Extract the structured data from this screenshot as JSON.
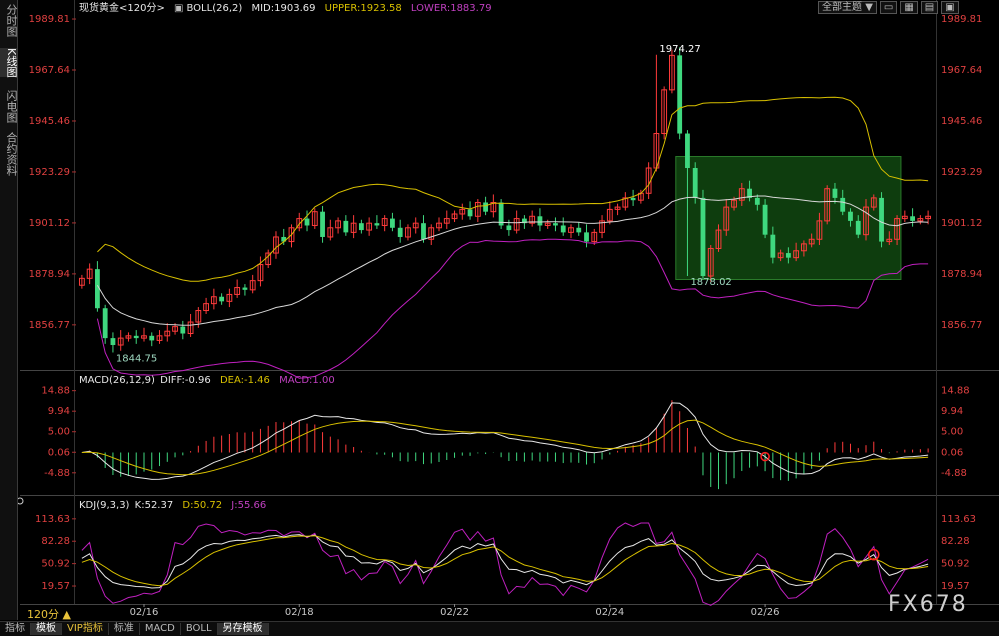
{
  "sidebar": {
    "tabs": [
      {
        "label": "分时图",
        "active": false
      },
      {
        "label": "K线图",
        "active": true
      },
      {
        "label": "闪电图",
        "active": false
      },
      {
        "label": "合约资料",
        "active": false
      }
    ]
  },
  "toolbar": {
    "theme_button": "全部主题",
    "dropdown_icon": "▼"
  },
  "period": "120分 ▲",
  "bottom_tabs": [
    {
      "label": "指标",
      "active": false,
      "vip": false
    },
    {
      "label": "模板",
      "active": true,
      "vip": false
    },
    {
      "label": "VIP指标",
      "active": false,
      "vip": true
    },
    {
      "label": "标准",
      "active": false,
      "vip": false
    },
    {
      "label": "MACD",
      "active": false,
      "vip": false
    },
    {
      "label": "BOLL",
      "active": false,
      "vip": false
    },
    {
      "label": "另存模板",
      "active": false,
      "vip": false
    }
  ],
  "watermark": "FX678",
  "colors": {
    "up": "#ff3b3b",
    "down": "#3fd87f",
    "mid": "#d8d8d8",
    "upper": "#d8c000",
    "lower": "#c020c0",
    "k": "#e8e8e8",
    "d": "#d8c000",
    "j": "#c020c0",
    "highlight": "#0e3d0e"
  },
  "chart_data": [
    {
      "type": "candlestick",
      "name_label": "现货黄金<120分>",
      "legend": {
        "indicator": "BOLL(26,2)",
        "mid": "MID:1903.69",
        "upper": "UPPER:1923.58",
        "lower": "LOWER:1883.79"
      },
      "ylim": [
        1838,
        1992
      ],
      "yticks": [
        1989.81,
        1967.64,
        1945.46,
        1923.29,
        1901.12,
        1878.94,
        1856.77
      ],
      "ytick_labels": [
        "1989.81",
        "1967.64",
        "1945.46",
        "1923.29",
        "1901.12",
        "1878.94",
        "1856.77"
      ],
      "xtick_labels": [
        "02/16",
        "02/18",
        "02/22",
        "02/24",
        "02/26"
      ],
      "xtick_index": [
        8,
        28,
        48,
        68,
        88
      ],
      "annotations": [
        {
          "label": "1974.27",
          "index": 74,
          "value": 1974.27
        },
        {
          "label": "1844.75",
          "index": 4,
          "value": 1844.75
        },
        {
          "label": "1878.02",
          "index": 78,
          "value": 1878.02
        }
      ],
      "highlight_region": {
        "from_index": 77,
        "to_index": 105,
        "y_from": 1876.5,
        "y_to": 1930
      },
      "close": [
        1877,
        1881,
        1864,
        1851,
        1848,
        1851,
        1852,
        1851,
        1852,
        1850,
        1852,
        1854,
        1856,
        1853,
        1858,
        1863,
        1866,
        1869,
        1867,
        1870,
        1873,
        1872,
        1876,
        1883,
        1888,
        1895,
        1893,
        1899,
        1903,
        1900,
        1906,
        1895,
        1899,
        1902,
        1897,
        1901,
        1898,
        1901,
        1900,
        1903,
        1899,
        1895,
        1899,
        1901,
        1894,
        1899,
        1901,
        1903,
        1905,
        1907,
        1904,
        1910,
        1906,
        1910,
        1900,
        1898,
        1903,
        1901,
        1904,
        1900,
        1901,
        1900,
        1897,
        1899,
        1897,
        1893,
        1897,
        1902,
        1907,
        1908,
        1912,
        1911,
        1914,
        1925,
        1940,
        1959,
        1974,
        1940,
        1925,
        1912,
        1878,
        1890,
        1898,
        1908,
        1911,
        1916,
        1912,
        1909,
        1896,
        1886,
        1888,
        1886,
        1889,
        1892,
        1894,
        1902,
        1916,
        1912,
        1906,
        1902,
        1896,
        1908,
        1912,
        1893,
        1894,
        1903,
        1904,
        1902,
        1903,
        1904
      ],
      "macd": {
        "legend": {
          "indicator": "MACD(26,12,9)",
          "diff": "DIFF:-0.96",
          "dea": "DEA:-1.46",
          "macd": "MACD:1.00"
        },
        "ylim": [
          -9.5,
          16
        ],
        "yticks": [
          14.88,
          9.94,
          5.0,
          0.06,
          -4.88
        ],
        "ytick_labels": [
          "14.88",
          "9.94",
          "5.00",
          "0.06",
          "-4.88"
        ],
        "circle_index": 88
      },
      "kdj": {
        "legend": {
          "indicator": "KDJ(9,3,3)",
          "k": "K:52.37",
          "d": "D:50.72",
          "j": "J:55.66"
        },
        "ylim": [
          0,
          126
        ],
        "yticks": [
          113.63,
          82.28,
          50.92,
          19.57
        ],
        "ytick_labels": [
          "113.63",
          "82.28",
          "50.92",
          "19.57"
        ],
        "circle_index": 102
      }
    }
  ]
}
